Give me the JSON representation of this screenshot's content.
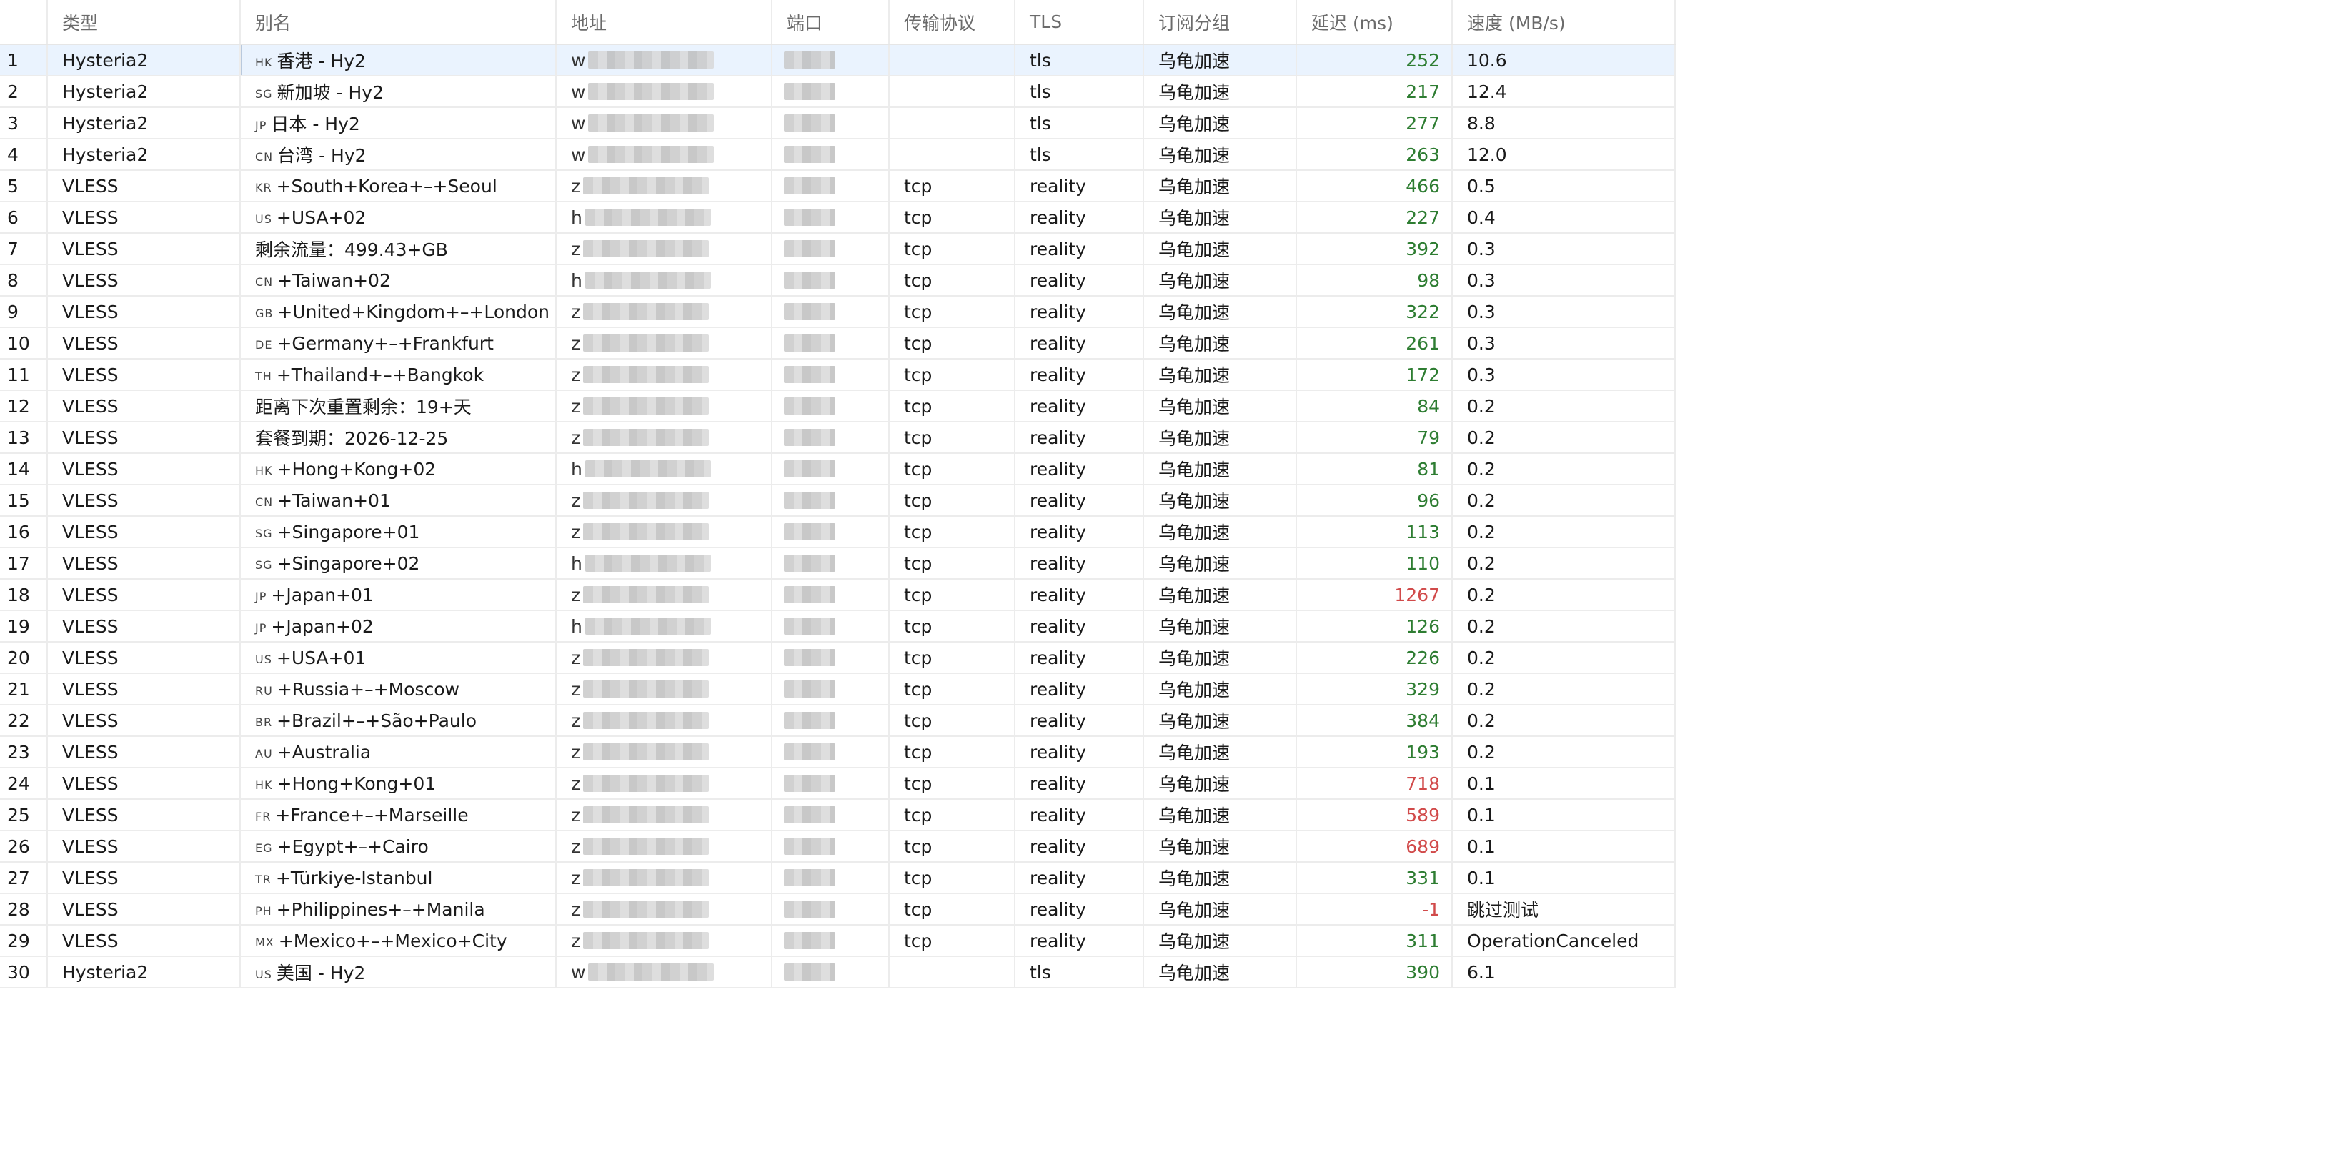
{
  "columns": {
    "idx": "",
    "type": "类型",
    "alias": "别名",
    "address": "地址",
    "port": "端口",
    "transport": "传输协议",
    "tls": "TLS",
    "group": "订阅分组",
    "latency": "延迟 (ms)",
    "speed": "速度 (MB/s)"
  },
  "colors": {
    "latency_good": "#2e7d32",
    "latency_bad": "#d14a4a",
    "selected_row": "#eaf3fe"
  },
  "selected_row": 1,
  "rows": [
    {
      "idx": "1",
      "type": "Hysteria2",
      "flag": "HK",
      "alias": "香港 - Hy2",
      "addr_lead": "w",
      "transport": "",
      "tls": "tls",
      "group": "乌龟加速",
      "latency": "252",
      "lat_bad": false,
      "speed": "10.6"
    },
    {
      "idx": "2",
      "type": "Hysteria2",
      "flag": "SG",
      "alias": "新加坡 - Hy2",
      "addr_lead": "w",
      "transport": "",
      "tls": "tls",
      "group": "乌龟加速",
      "latency": "217",
      "lat_bad": false,
      "speed": "12.4"
    },
    {
      "idx": "3",
      "type": "Hysteria2",
      "flag": "JP",
      "alias": "日本 - Hy2",
      "addr_lead": "w",
      "transport": "",
      "tls": "tls",
      "group": "乌龟加速",
      "latency": "277",
      "lat_bad": false,
      "speed": "8.8"
    },
    {
      "idx": "4",
      "type": "Hysteria2",
      "flag": "CN",
      "alias": "台湾 - Hy2",
      "addr_lead": "w",
      "transport": "",
      "tls": "tls",
      "group": "乌龟加速",
      "latency": "263",
      "lat_bad": false,
      "speed": "12.0"
    },
    {
      "idx": "5",
      "type": "VLESS",
      "flag": "KR",
      "alias": "+South+Korea+–+Seoul",
      "addr_lead": "z",
      "transport": "tcp",
      "tls": "reality",
      "group": "乌龟加速",
      "latency": "466",
      "lat_bad": false,
      "speed": "0.5"
    },
    {
      "idx": "6",
      "type": "VLESS",
      "flag": "US",
      "alias": "+USA+02",
      "addr_lead": "h",
      "transport": "tcp",
      "tls": "reality",
      "group": "乌龟加速",
      "latency": "227",
      "lat_bad": false,
      "speed": "0.4"
    },
    {
      "idx": "7",
      "type": "VLESS",
      "flag": "",
      "alias": "剩余流量：499.43+GB",
      "addr_lead": "z",
      "transport": "tcp",
      "tls": "reality",
      "group": "乌龟加速",
      "latency": "392",
      "lat_bad": false,
      "speed": "0.3"
    },
    {
      "idx": "8",
      "type": "VLESS",
      "flag": "CN",
      "alias": "+Taiwan+02",
      "addr_lead": "h",
      "transport": "tcp",
      "tls": "reality",
      "group": "乌龟加速",
      "latency": "98",
      "lat_bad": false,
      "speed": "0.3"
    },
    {
      "idx": "9",
      "type": "VLESS",
      "flag": "GB",
      "alias": "+United+Kingdom+–+London",
      "addr_lead": "z",
      "transport": "tcp",
      "tls": "reality",
      "group": "乌龟加速",
      "latency": "322",
      "lat_bad": false,
      "speed": "0.3"
    },
    {
      "idx": "10",
      "type": "VLESS",
      "flag": "DE",
      "alias": "+Germany+–+Frankfurt",
      "addr_lead": "z",
      "transport": "tcp",
      "tls": "reality",
      "group": "乌龟加速",
      "latency": "261",
      "lat_bad": false,
      "speed": "0.3"
    },
    {
      "idx": "11",
      "type": "VLESS",
      "flag": "TH",
      "alias": "+Thailand+–+Bangkok",
      "addr_lead": "z",
      "transport": "tcp",
      "tls": "reality",
      "group": "乌龟加速",
      "latency": "172",
      "lat_bad": false,
      "speed": "0.3"
    },
    {
      "idx": "12",
      "type": "VLESS",
      "flag": "",
      "alias": "距离下次重置剩余：19+天",
      "addr_lead": "z",
      "transport": "tcp",
      "tls": "reality",
      "group": "乌龟加速",
      "latency": "84",
      "lat_bad": false,
      "speed": "0.2"
    },
    {
      "idx": "13",
      "type": "VLESS",
      "flag": "",
      "alias": "套餐到期：2026-12-25",
      "addr_lead": "z",
      "transport": "tcp",
      "tls": "reality",
      "group": "乌龟加速",
      "latency": "79",
      "lat_bad": false,
      "speed": "0.2"
    },
    {
      "idx": "14",
      "type": "VLESS",
      "flag": "HK",
      "alias": "+Hong+Kong+02",
      "addr_lead": "h",
      "transport": "tcp",
      "tls": "reality",
      "group": "乌龟加速",
      "latency": "81",
      "lat_bad": false,
      "speed": "0.2"
    },
    {
      "idx": "15",
      "type": "VLESS",
      "flag": "CN",
      "alias": "+Taiwan+01",
      "addr_lead": "z",
      "transport": "tcp",
      "tls": "reality",
      "group": "乌龟加速",
      "latency": "96",
      "lat_bad": false,
      "speed": "0.2"
    },
    {
      "idx": "16",
      "type": "VLESS",
      "flag": "SG",
      "alias": "+Singapore+01",
      "addr_lead": "z",
      "transport": "tcp",
      "tls": "reality",
      "group": "乌龟加速",
      "latency": "113",
      "lat_bad": false,
      "speed": "0.2"
    },
    {
      "idx": "17",
      "type": "VLESS",
      "flag": "SG",
      "alias": "+Singapore+02",
      "addr_lead": "h",
      "transport": "tcp",
      "tls": "reality",
      "group": "乌龟加速",
      "latency": "110",
      "lat_bad": false,
      "speed": "0.2"
    },
    {
      "idx": "18",
      "type": "VLESS",
      "flag": "JP",
      "alias": "+Japan+01",
      "addr_lead": "z",
      "transport": "tcp",
      "tls": "reality",
      "group": "乌龟加速",
      "latency": "1267",
      "lat_bad": true,
      "speed": "0.2"
    },
    {
      "idx": "19",
      "type": "VLESS",
      "flag": "JP",
      "alias": "+Japan+02",
      "addr_lead": "h",
      "transport": "tcp",
      "tls": "reality",
      "group": "乌龟加速",
      "latency": "126",
      "lat_bad": false,
      "speed": "0.2"
    },
    {
      "idx": "20",
      "type": "VLESS",
      "flag": "US",
      "alias": "+USA+01",
      "addr_lead": "z",
      "transport": "tcp",
      "tls": "reality",
      "group": "乌龟加速",
      "latency": "226",
      "lat_bad": false,
      "speed": "0.2"
    },
    {
      "idx": "21",
      "type": "VLESS",
      "flag": "RU",
      "alias": "+Russia+–+Moscow",
      "addr_lead": "z",
      "transport": "tcp",
      "tls": "reality",
      "group": "乌龟加速",
      "latency": "329",
      "lat_bad": false,
      "speed": "0.2"
    },
    {
      "idx": "22",
      "type": "VLESS",
      "flag": "BR",
      "alias": "+Brazil+–+São+Paulo",
      "addr_lead": "z",
      "transport": "tcp",
      "tls": "reality",
      "group": "乌龟加速",
      "latency": "384",
      "lat_bad": false,
      "speed": "0.2"
    },
    {
      "idx": "23",
      "type": "VLESS",
      "flag": "AU",
      "alias": "+Australia",
      "addr_lead": "z",
      "transport": "tcp",
      "tls": "reality",
      "group": "乌龟加速",
      "latency": "193",
      "lat_bad": false,
      "speed": "0.2"
    },
    {
      "idx": "24",
      "type": "VLESS",
      "flag": "HK",
      "alias": "+Hong+Kong+01",
      "addr_lead": "z",
      "transport": "tcp",
      "tls": "reality",
      "group": "乌龟加速",
      "latency": "718",
      "lat_bad": true,
      "speed": "0.1"
    },
    {
      "idx": "25",
      "type": "VLESS",
      "flag": "FR",
      "alias": "+France+–+Marseille",
      "addr_lead": "z",
      "transport": "tcp",
      "tls": "reality",
      "group": "乌龟加速",
      "latency": "589",
      "lat_bad": true,
      "speed": "0.1"
    },
    {
      "idx": "26",
      "type": "VLESS",
      "flag": "EG",
      "alias": "+Egypt+–+Cairo",
      "addr_lead": "z",
      "transport": "tcp",
      "tls": "reality",
      "group": "乌龟加速",
      "latency": "689",
      "lat_bad": true,
      "speed": "0.1"
    },
    {
      "idx": "27",
      "type": "VLESS",
      "flag": "TR",
      "alias": "+Türkiye-Istanbul",
      "addr_lead": "z",
      "transport": "tcp",
      "tls": "reality",
      "group": "乌龟加速",
      "latency": "331",
      "lat_bad": false,
      "speed": "0.1"
    },
    {
      "idx": "28",
      "type": "VLESS",
      "flag": "PH",
      "alias": "+Philippines+–+Manila",
      "addr_lead": "z",
      "transport": "tcp",
      "tls": "reality",
      "group": "乌龟加速",
      "latency": "-1",
      "lat_bad": true,
      "speed": "跳过测试"
    },
    {
      "idx": "29",
      "type": "VLESS",
      "flag": "MX",
      "alias": "+Mexico+–+Mexico+City",
      "addr_lead": "z",
      "transport": "tcp",
      "tls": "reality",
      "group": "乌龟加速",
      "latency": "311",
      "lat_bad": false,
      "speed": "OperationCanceled"
    },
    {
      "idx": "30",
      "type": "Hysteria2",
      "flag": "US",
      "alias": "美国 - Hy2",
      "addr_lead": "w",
      "transport": "",
      "tls": "tls",
      "group": "乌龟加速",
      "latency": "390",
      "lat_bad": false,
      "speed": "6.1"
    }
  ]
}
